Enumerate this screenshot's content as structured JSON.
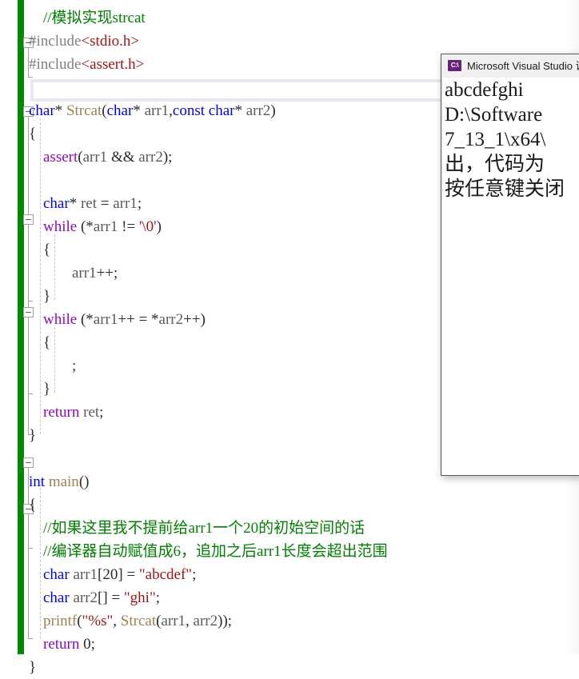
{
  "editor": {
    "change_bar_color": "#008a00",
    "code_lines": [
      {
        "indent": 1,
        "segments": [
          {
            "t": "//模拟实现strcat",
            "c": "cmt"
          }
        ]
      },
      {
        "indent": 0,
        "segments": [
          {
            "t": "#include",
            "c": "inc"
          },
          {
            "t": "<stdio.h>",
            "c": "hdr"
          }
        ]
      },
      {
        "indent": 0,
        "segments": [
          {
            "t": "#include",
            "c": "inc"
          },
          {
            "t": "<assert.h>",
            "c": "hdr"
          }
        ]
      },
      {
        "indent": 0,
        "segments": [
          {
            "t": "",
            "c": "pl"
          }
        ]
      },
      {
        "indent": 0,
        "segments": [
          {
            "t": "char",
            "c": "kw"
          },
          {
            "t": "* ",
            "c": "pl"
          },
          {
            "t": "Strcat",
            "c": "fn"
          },
          {
            "t": "(",
            "c": "pl"
          },
          {
            "t": "char",
            "c": "kw"
          },
          {
            "t": "* ",
            "c": "pl"
          },
          {
            "t": "arr1",
            "c": "id"
          },
          {
            "t": ",",
            "c": "pl"
          },
          {
            "t": "const",
            "c": "kw"
          },
          {
            "t": " ",
            "c": "pl"
          },
          {
            "t": "char",
            "c": "kw"
          },
          {
            "t": "* ",
            "c": "pl"
          },
          {
            "t": "arr2",
            "c": "id"
          },
          {
            "t": ")",
            "c": "pl"
          }
        ]
      },
      {
        "indent": 0,
        "segments": [
          {
            "t": "{",
            "c": "pl"
          }
        ]
      },
      {
        "indent": 1,
        "segments": [
          {
            "t": "assert",
            "c": "kw2"
          },
          {
            "t": "(",
            "c": "pl"
          },
          {
            "t": "arr1",
            "c": "id"
          },
          {
            "t": " && ",
            "c": "pl"
          },
          {
            "t": "arr2",
            "c": "id"
          },
          {
            "t": ");",
            "c": "pl"
          }
        ]
      },
      {
        "indent": 1,
        "segments": [
          {
            "t": "",
            "c": "pl"
          }
        ]
      },
      {
        "indent": 1,
        "segments": [
          {
            "t": "char",
            "c": "kw"
          },
          {
            "t": "* ",
            "c": "pl"
          },
          {
            "t": "ret",
            "c": "id"
          },
          {
            "t": " = ",
            "c": "pl"
          },
          {
            "t": "arr1",
            "c": "id"
          },
          {
            "t": ";",
            "c": "pl"
          }
        ]
      },
      {
        "indent": 1,
        "segments": [
          {
            "t": "while",
            "c": "kw2"
          },
          {
            "t": " (*",
            "c": "pl"
          },
          {
            "t": "arr1",
            "c": "id"
          },
          {
            "t": " != ",
            "c": "pl"
          },
          {
            "t": "'\\0'",
            "c": "str"
          },
          {
            "t": ")",
            "c": "pl"
          }
        ]
      },
      {
        "indent": 1,
        "segments": [
          {
            "t": "{",
            "c": "pl"
          }
        ]
      },
      {
        "indent": 2,
        "segments": [
          {
            "t": "arr1",
            "c": "id"
          },
          {
            "t": "++;",
            "c": "pl"
          }
        ]
      },
      {
        "indent": 1,
        "segments": [
          {
            "t": "}",
            "c": "pl"
          }
        ]
      },
      {
        "indent": 1,
        "segments": [
          {
            "t": "while",
            "c": "kw2"
          },
          {
            "t": " (*",
            "c": "pl"
          },
          {
            "t": "arr1",
            "c": "id"
          },
          {
            "t": "++ = *",
            "c": "pl"
          },
          {
            "t": "arr2",
            "c": "id"
          },
          {
            "t": "++)",
            "c": "pl"
          }
        ]
      },
      {
        "indent": 1,
        "segments": [
          {
            "t": "{",
            "c": "pl"
          }
        ]
      },
      {
        "indent": 2,
        "segments": [
          {
            "t": ";",
            "c": "pl"
          }
        ]
      },
      {
        "indent": 1,
        "segments": [
          {
            "t": "}",
            "c": "pl"
          }
        ]
      },
      {
        "indent": 1,
        "segments": [
          {
            "t": "return",
            "c": "kw2"
          },
          {
            "t": " ",
            "c": "pl"
          },
          {
            "t": "ret",
            "c": "id"
          },
          {
            "t": ";",
            "c": "pl"
          }
        ]
      },
      {
        "indent": 0,
        "segments": [
          {
            "t": "}",
            "c": "pl"
          }
        ]
      },
      {
        "indent": 0,
        "segments": [
          {
            "t": "",
            "c": "pl"
          }
        ]
      },
      {
        "indent": 0,
        "segments": [
          {
            "t": "int",
            "c": "kw"
          },
          {
            "t": " ",
            "c": "pl"
          },
          {
            "t": "main",
            "c": "fn"
          },
          {
            "t": "()",
            "c": "pl"
          }
        ]
      },
      {
        "indent": 0,
        "segments": [
          {
            "t": "{",
            "c": "pl"
          }
        ]
      },
      {
        "indent": 1,
        "segments": [
          {
            "t": "//如果这里我不提前给arr1一个20的初始空间的话",
            "c": "cmt"
          }
        ]
      },
      {
        "indent": 1,
        "segments": [
          {
            "t": "//编译器自动赋值成6，追加之后arr1长度会超出范围",
            "c": "cmt"
          }
        ]
      },
      {
        "indent": 1,
        "segments": [
          {
            "t": "char",
            "c": "kw"
          },
          {
            "t": " ",
            "c": "pl"
          },
          {
            "t": "arr1",
            "c": "id"
          },
          {
            "t": "[",
            "c": "pl"
          },
          {
            "t": "20",
            "c": "num"
          },
          {
            "t": "] = ",
            "c": "pl"
          },
          {
            "t": "\"abcdef\"",
            "c": "str"
          },
          {
            "t": ";",
            "c": "pl"
          }
        ]
      },
      {
        "indent": 1,
        "segments": [
          {
            "t": "char",
            "c": "kw"
          },
          {
            "t": " ",
            "c": "pl"
          },
          {
            "t": "arr2",
            "c": "id"
          },
          {
            "t": "[] = ",
            "c": "pl"
          },
          {
            "t": "\"ghi\"",
            "c": "str"
          },
          {
            "t": ";",
            "c": "pl"
          }
        ]
      },
      {
        "indent": 1,
        "segments": [
          {
            "t": "printf",
            "c": "fn"
          },
          {
            "t": "(",
            "c": "pl"
          },
          {
            "t": "\"%s\"",
            "c": "str"
          },
          {
            "t": ", ",
            "c": "pl"
          },
          {
            "t": "Strcat",
            "c": "fn"
          },
          {
            "t": "(",
            "c": "pl"
          },
          {
            "t": "arr1",
            "c": "id"
          },
          {
            "t": ", ",
            "c": "pl"
          },
          {
            "t": "arr2",
            "c": "id"
          },
          {
            "t": "));",
            "c": "pl"
          }
        ]
      },
      {
        "indent": 1,
        "segments": [
          {
            "t": "return",
            "c": "kw2"
          },
          {
            "t": " ",
            "c": "pl"
          },
          {
            "t": "0",
            "c": "num"
          },
          {
            "t": ";",
            "c": "pl"
          }
        ]
      },
      {
        "indent": 0,
        "segments": [
          {
            "t": "}",
            "c": "pl"
          }
        ]
      }
    ],
    "syntax_colors": {
      "comment": "#008000",
      "keyword": "#0000ff",
      "control_keyword": "#8f08c4",
      "string": "#a31515",
      "header": "#a31515",
      "preprocessor": "#808080",
      "function": "#a08050",
      "identifier": "#5a5a5a",
      "plain": "#2b2b2b"
    }
  },
  "console": {
    "title": "Microsoft Visual Studio 调",
    "icon": "console-window-icon",
    "icon_label": "C:\\",
    "icon_color": "#68217a",
    "lines": [
      "abcdefghi",
      "D:\\Software",
      "7_13_1\\x64\\",
      "出，代码为",
      "按任意键关闭"
    ]
  }
}
